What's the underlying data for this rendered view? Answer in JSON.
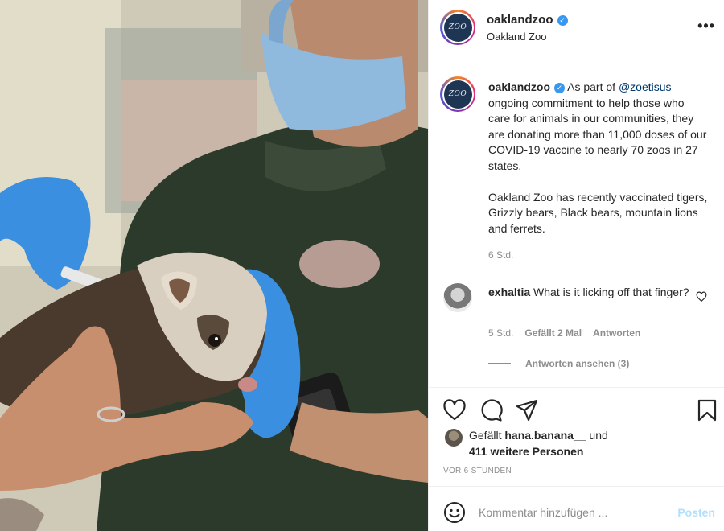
{
  "post": {
    "image_alt": "",
    "image_icon": "ferret-vaccination-photo"
  },
  "header": {
    "username": "oaklandzoo",
    "location": "Oakland Zoo",
    "verified_icon": "verified-badge-icon",
    "more_icon": "more-options-icon",
    "more_label": "•••",
    "avatar_text": "ZOO"
  },
  "caption": {
    "username": "oaklandzoo",
    "before_mention": " As part of ",
    "mention": "@zoetisus",
    "after_mention": " ongoing commitment to help those who care for animals in our communities, they are donating more than 11,000 doses of our COVID-19 vaccine to nearly 70 zoos in 27 states.",
    "paragraph2": "Oakland Zoo has recently vaccinated tigers, Grizzly bears, Black bears, mountain lions and ferrets.",
    "time": "6 Std."
  },
  "comment": {
    "username": "exhaltia",
    "text": " What is it licking off that finger?",
    "time": "5 Std.",
    "likes": "Gefällt 2 Mal",
    "reply": "Antworten",
    "view_replies": "Antworten ansehen (3)"
  },
  "actions": {
    "like_icon": "heart-icon",
    "comment_icon": "comment-bubble-icon",
    "share_icon": "send-paper-plane-icon",
    "save_icon": "bookmark-icon"
  },
  "likes": {
    "prefix": "Gefällt ",
    "user": "hana.banana__",
    "suffix": " und",
    "others": "411 weitere Personen"
  },
  "timestamp": "VOR 6 STUNDEN",
  "add_comment": {
    "placeholder": "Kommentar hinzufügen ...",
    "post_label": "Posten"
  },
  "colors": {
    "link": "#00376b",
    "verified": "#3897f0",
    "muted": "#8e8e8e",
    "post_disabled": "#b2dffc",
    "glove": "#3a8fe0"
  }
}
